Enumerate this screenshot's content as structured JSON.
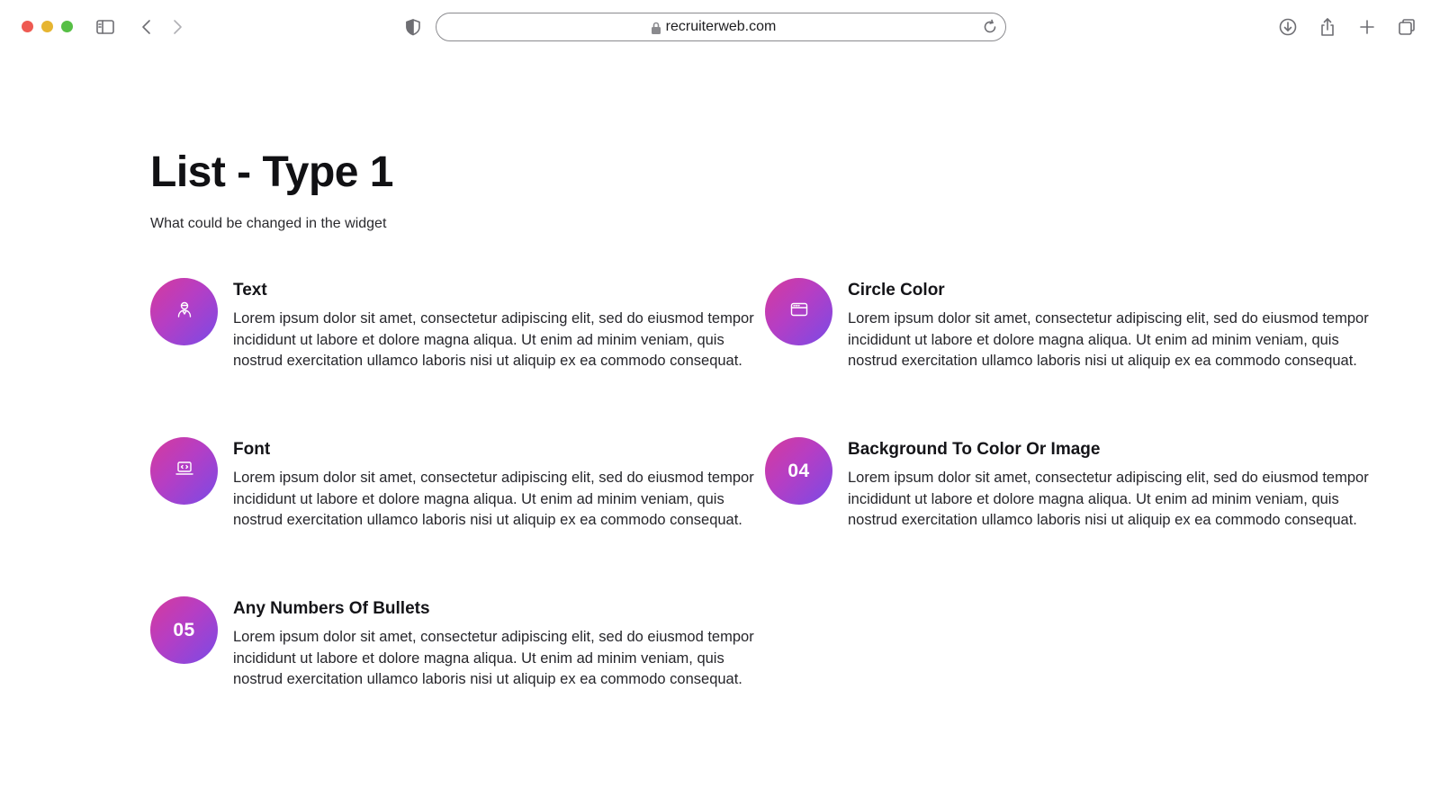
{
  "browser": {
    "url": "recruiterweb.com",
    "icons": {
      "sidebar": "sidebar-icon",
      "back": "chevron-left-icon",
      "forward": "chevron-right-icon",
      "shield": "privacy-shield-icon",
      "lock": "lock-icon",
      "reload": "reload-icon",
      "download": "download-icon",
      "share": "share-icon",
      "new_tab": "plus-icon",
      "tabs": "tab-overview-icon"
    }
  },
  "page": {
    "title": "List - Type 1",
    "subtitle": "What could be changed in the widget"
  },
  "items": [
    {
      "badge_icon": "user-icon",
      "title": "Text",
      "body": "Lorem ipsum dolor sit amet, consectetur adipiscing elit, sed do eiusmod tempor incididunt ut labore et dolore magna aliqua. Ut enim ad minim veniam, quis nostrud exercitation ullamco laboris nisi ut aliquip ex ea commodo consequat."
    },
    {
      "badge_icon": "browser-window-icon",
      "title": "Circle Color",
      "body": "Lorem ipsum dolor sit amet, consectetur adipiscing elit, sed do eiusmod tempor incididunt ut labore et dolore magna aliqua. Ut enim ad minim veniam, quis nostrud exercitation ullamco laboris nisi ut aliquip ex ea commodo consequat."
    },
    {
      "badge_icon": "laptop-code-icon",
      "title": "Font",
      "body": "Lorem ipsum dolor sit amet, consectetur adipiscing elit, sed do eiusmod tempor incididunt ut labore et dolore magna aliqua. Ut enim ad minim veniam, quis nostrud exercitation ullamco laboris nisi ut aliquip ex ea commodo consequat."
    },
    {
      "badge_number": "04",
      "title": "Background To Color Or Image",
      "body": "Lorem ipsum dolor sit amet, consectetur adipiscing elit, sed do eiusmod tempor incididunt ut labore et dolore magna aliqua. Ut enim ad minim veniam, quis nostrud exercitation ullamco laboris nisi ut aliquip ex ea commodo consequat."
    },
    {
      "badge_number": "05",
      "title": "Any Numbers Of Bullets",
      "body": "Lorem ipsum dolor sit amet, consectetur adipiscing elit, sed do eiusmod tempor incididunt ut labore et dolore magna aliqua. Ut enim ad minim veniam, quis nostrud exercitation ullamco laboris nisi ut aliquip ex ea commodo consequat."
    }
  ],
  "colors": {
    "circle_gradient_start": "#d63a9c",
    "circle_gradient_mid": "#b53ec4",
    "circle_gradient_end": "#7a4ae6",
    "heading": "#111114",
    "body_text": "#26262b"
  }
}
